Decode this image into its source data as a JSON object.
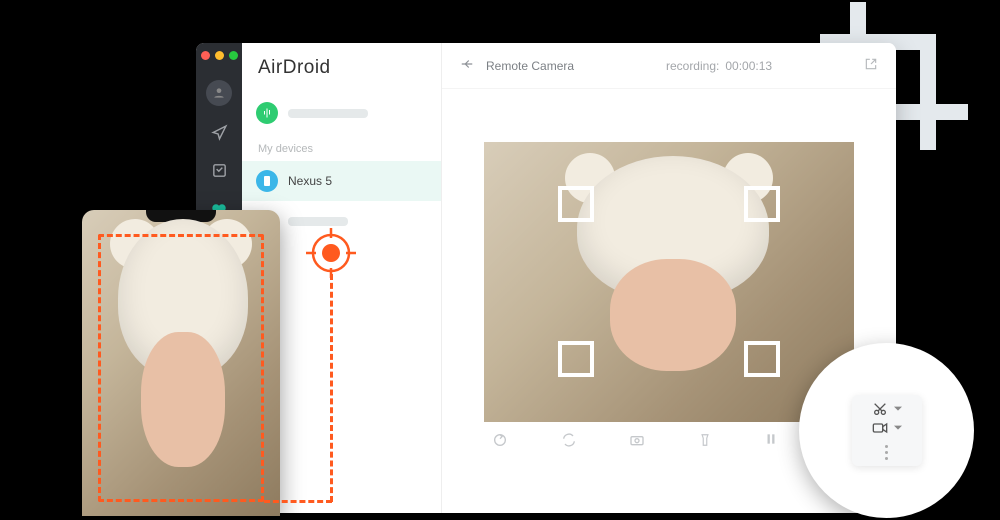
{
  "brand": "AirDroid",
  "sidebar": {
    "section_label": "My devices",
    "devices": [
      {
        "name": "",
        "icon": "cactus",
        "color": "green"
      },
      {
        "name": "Nexus 5",
        "icon": "phone",
        "color": "blue"
      },
      {
        "name": "",
        "icon": "phone",
        "color": "blue"
      }
    ]
  },
  "main": {
    "title": "Remote Camera",
    "status_label": "recording:",
    "status_time": "00:00:13",
    "toolbar": {
      "rotate": "↻",
      "switch_camera": "⟳",
      "flash": "⚡",
      "torch": "⫾",
      "pause": "❚❚",
      "refresh": "↻"
    }
  },
  "zoom_menu": {
    "snip": "Snip",
    "record": "Record"
  },
  "colors": {
    "accent_orange": "#ff5a1f",
    "accent_teal": "#1abc9c"
  }
}
